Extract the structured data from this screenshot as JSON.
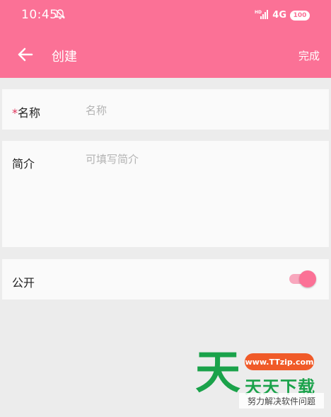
{
  "status_bar": {
    "time": "10:45",
    "network": "4G",
    "battery": "100"
  },
  "appbar": {
    "title": "创建",
    "done_label": "完成"
  },
  "form": {
    "name": {
      "required_mark": "*",
      "label": "名称",
      "placeholder": "名称",
      "value": ""
    },
    "intro": {
      "label": "简介",
      "placeholder": "可填写简介",
      "value": ""
    },
    "public": {
      "label": "公开",
      "enabled": true
    }
  },
  "watermark": {
    "big_char": "天",
    "url": "www.TTzip.com",
    "text": "天天下载",
    "tagline": "努力解决软件问题"
  },
  "colors": {
    "primary": "#fb7196",
    "background": "#ececec",
    "row_background": "#fafafa",
    "required": "#e0325a"
  }
}
